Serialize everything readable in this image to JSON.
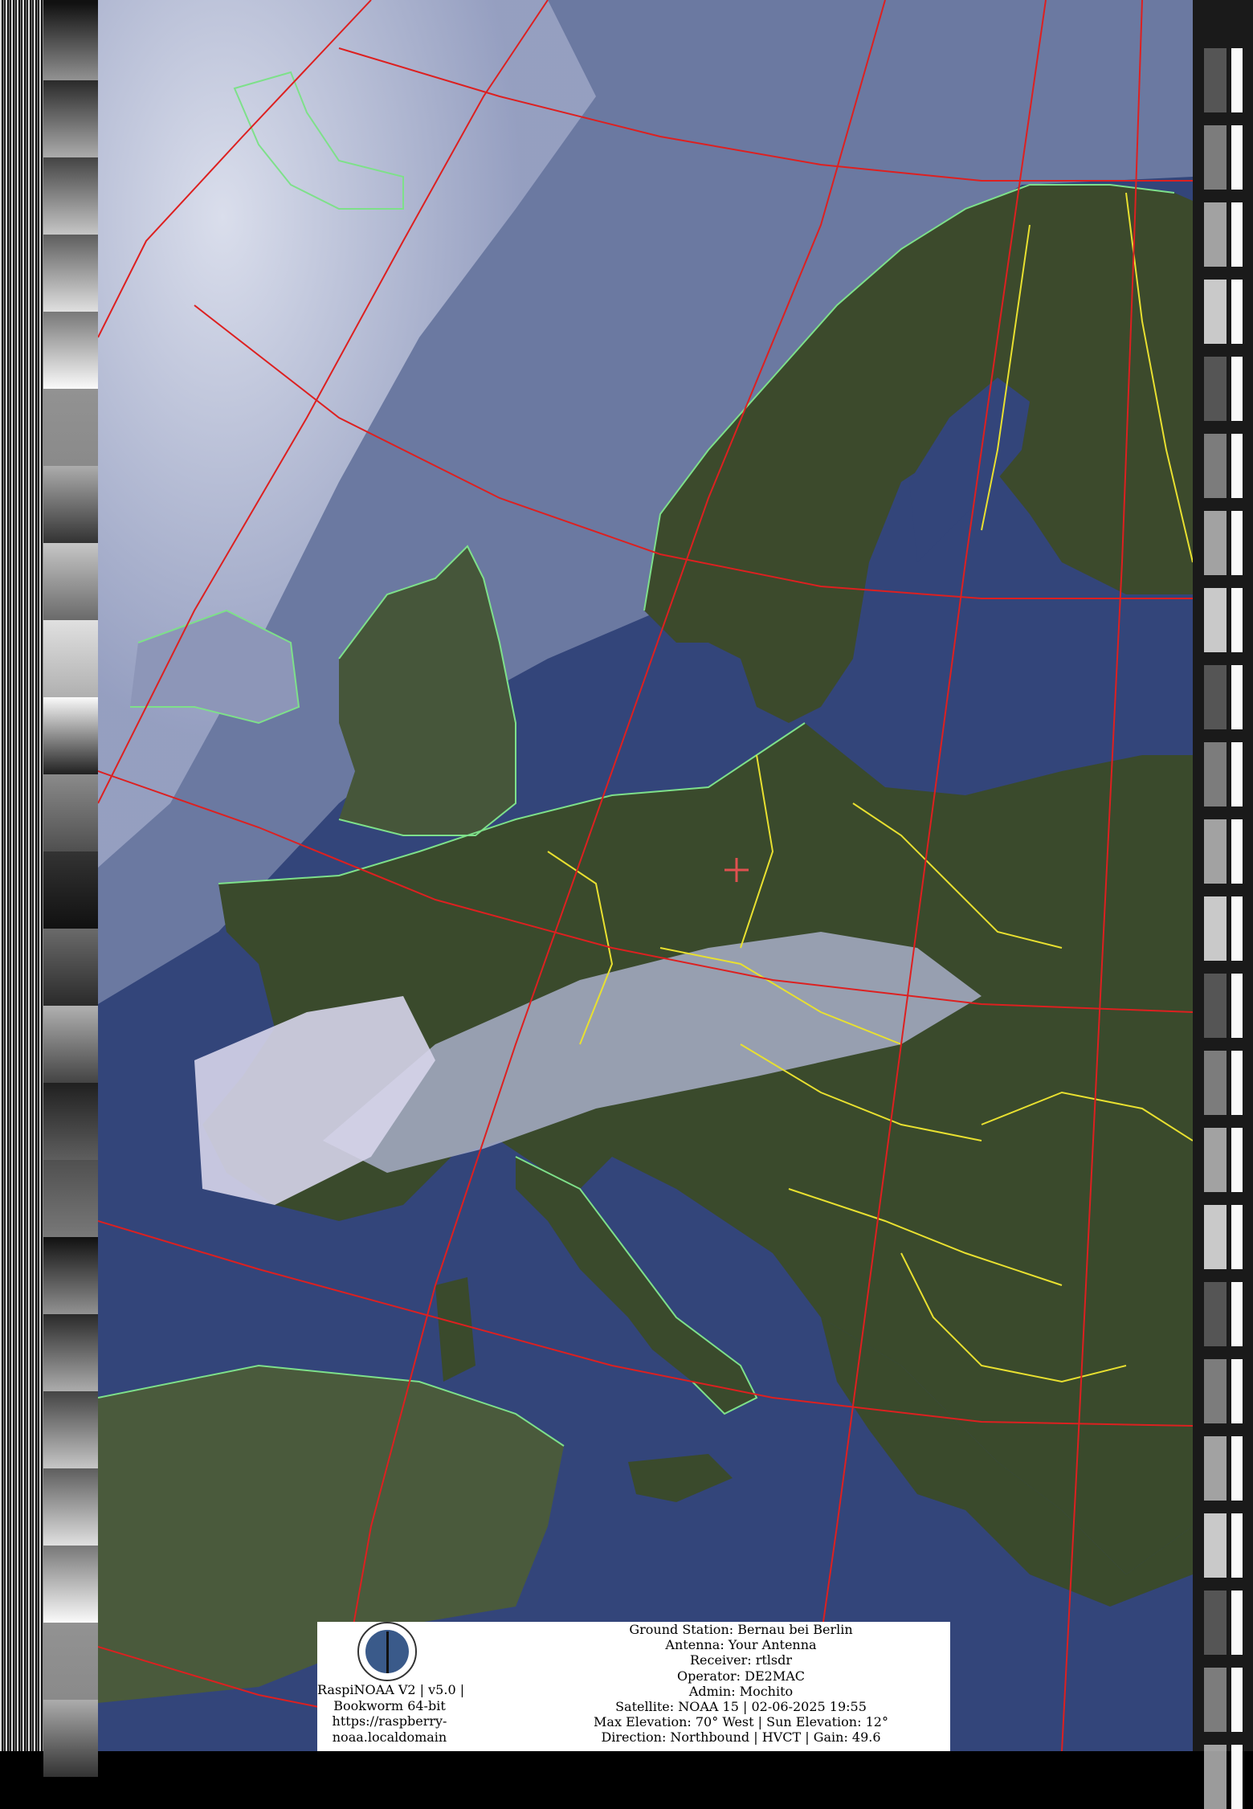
{
  "station_info": {
    "ground_station": "Ground Station: Bernau bei Berlin",
    "antenna": "Antenna: Your Antenna",
    "receiver": "Receiver: rtlsdr",
    "operator": "Operator: DE2MAC",
    "admin": "Admin: Mochito",
    "satellite": "Satellite: NOAA 15 | 02-06-2025 19:55",
    "elevation": "Max Elevation: 70° West | Sun Elevation: 12°",
    "direction": "Direction: Northbound | HVCT | Gain: 49.6"
  },
  "software_info": {
    "line1": "RaspiNOAA V2 | v5.0 |",
    "line2": "Bookworm 64-bit",
    "line3": "https://raspberry-",
    "line4": "noaa.localdomain"
  },
  "logo_icon": "antenna-logo-icon",
  "colors": {
    "graticule": "#dd2020",
    "coastline": "#7ee08a",
    "borders": "#e8e030",
    "sea": "#33457a",
    "land": "#3a4a2c",
    "cloud": "#c8cfe4",
    "ground_marker": "#e05050"
  }
}
